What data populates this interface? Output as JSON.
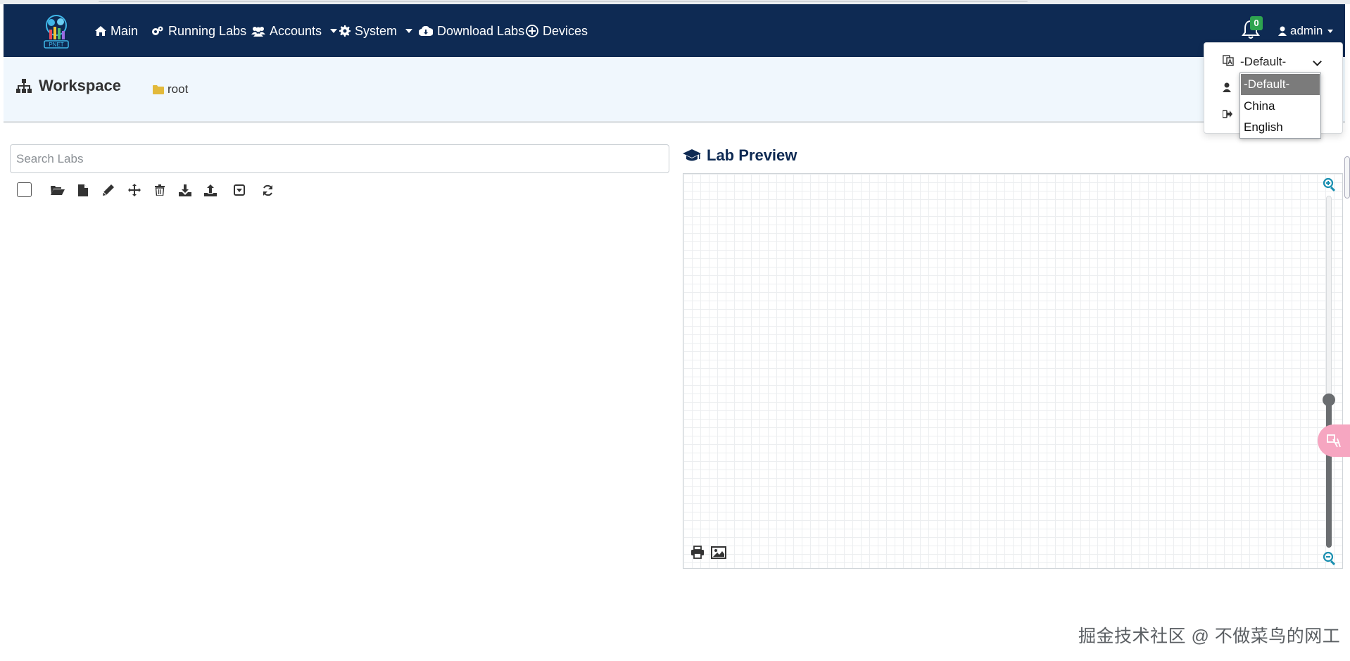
{
  "nav": {
    "items": [
      {
        "label": "Main",
        "icon": "home-icon"
      },
      {
        "label": "Running Labs",
        "icon": "gears-icon"
      },
      {
        "label": "Accounts",
        "icon": "users-icon"
      },
      {
        "label": "System",
        "icon": "cog-icon"
      },
      {
        "label": "Download Labs",
        "icon": "cloud-download-icon"
      },
      {
        "label": "Devices",
        "icon": "plus-circle-icon"
      }
    ],
    "notifications_count": "0",
    "user_label": "admin"
  },
  "workspace": {
    "title": "Workspace",
    "folder": "root"
  },
  "search": {
    "placeholder": "Search Labs",
    "value": ""
  },
  "lab_preview": {
    "title": "Lab Preview",
    "zoom_level_fraction": 0.42
  },
  "language": {
    "selected": "-Default-",
    "options": [
      "-Default-",
      "China",
      "English"
    ],
    "highlighted": "-Default-"
  },
  "watermark": "掘金技术社区 @ 不做菜鸟的网工",
  "colors": {
    "navbar": "#0e2a53",
    "workspace_bar": "#f0f7fd",
    "badge": "#2ea44f",
    "zoom_icon": "#1a8fb0"
  }
}
